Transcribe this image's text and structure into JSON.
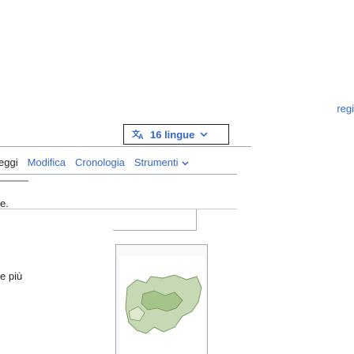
{
  "header": {
    "right_link": "regi"
  },
  "language_button": {
    "label": "16 lingue",
    "icon": "translate-icon"
  },
  "tabs": [
    {
      "label": "eggi",
      "active": false
    },
    {
      "label": "Modifica",
      "active": false
    },
    {
      "label": "Cronologia",
      "active": false
    },
    {
      "label": "Strumenti",
      "has_dropdown": true
    }
  ],
  "left_fragments": {
    "line1": "e.",
    "line2": "e più"
  },
  "colors": {
    "link": "#3366cc",
    "border": "#a2a9b1",
    "text": "#202122"
  }
}
